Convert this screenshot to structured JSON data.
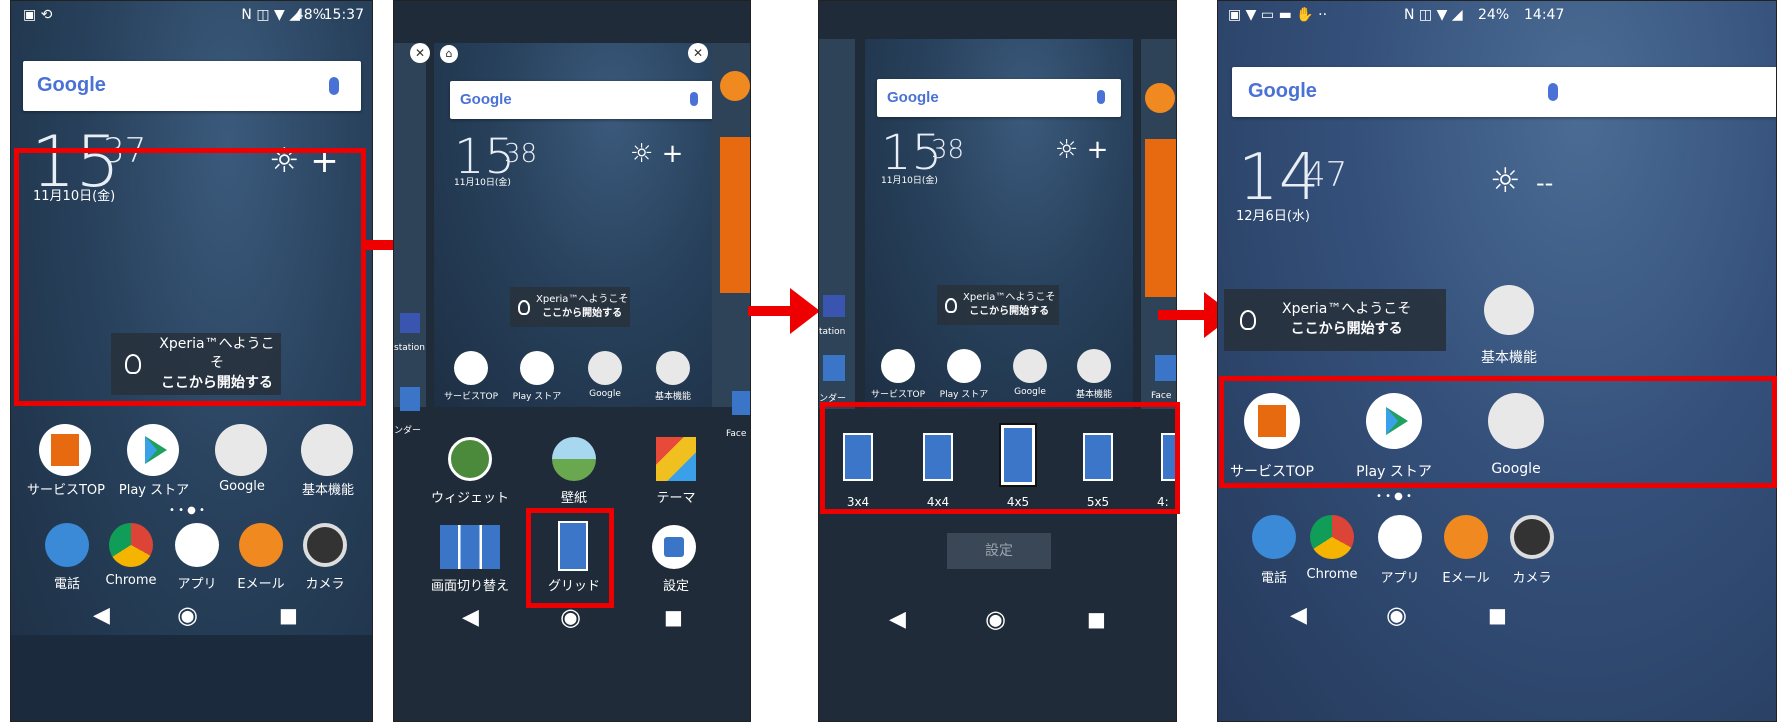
{
  "panel1": {
    "status": {
      "battery": "48%",
      "time": "15:37"
    },
    "google": "Google",
    "clock": {
      "hh": "15",
      "mm": "37"
    },
    "date": "11月10日(金)",
    "welcome": {
      "line1": "Xperia™へようこそ",
      "line2": "ここから開始する"
    },
    "apps": [
      "サービスTOP",
      "Play ストア",
      "Google",
      "基本機能"
    ],
    "dock": [
      "電話",
      "Chrome",
      "アプリ",
      "Eメール",
      "カメラ"
    ]
  },
  "panel2": {
    "google": "Google",
    "clock": {
      "hh": "15",
      "mm": "38"
    },
    "date": "11月10日(金)",
    "welcome": {
      "line1": "Xperia™へようこそ",
      "line2": "ここから開始する"
    },
    "apps": [
      "サービスTOP",
      "Play ストア",
      "Google",
      "基本機能"
    ],
    "side_left_label": "station",
    "side_left_label2": "ンダー",
    "side_right_label": "Face",
    "menu": [
      "ウィジェット",
      "壁紙",
      "テーマ",
      "画面切り替え",
      "グリッド",
      "設定"
    ]
  },
  "panel3": {
    "google": "Google",
    "clock": {
      "hh": "15",
      "mm": "38"
    },
    "date": "11月10日(金)",
    "welcome": {
      "line1": "Xperia™へようこそ",
      "line2": "ここから開始する"
    },
    "apps": [
      "サービスTOP",
      "Play ストア",
      "Google",
      "基本機能"
    ],
    "side_left_label": "tation",
    "side_left_label2": "ンダー",
    "side_right_label": "Face",
    "grids": [
      "3x4",
      "4x4",
      "4x5",
      "5x5",
      "4:"
    ],
    "settings_button": "設定"
  },
  "panel4": {
    "status": {
      "battery": "24%",
      "time": "14:47"
    },
    "google": "Google",
    "clock": {
      "hh": "14",
      "mm": "47"
    },
    "date": "12月6日(水)",
    "weather": "-- ",
    "welcome": {
      "line1": "Xperia™へようこそ",
      "line2": "ここから開始する"
    },
    "kihon": "基本機能",
    "apps": [
      "サービスTOP",
      "Play ストア",
      "Google"
    ],
    "dock": [
      "電話",
      "Chrome",
      "アプリ",
      "Eメール",
      "カメラ"
    ]
  },
  "colors": {
    "highlight": "#e00000",
    "accent": "#4a72d6"
  }
}
